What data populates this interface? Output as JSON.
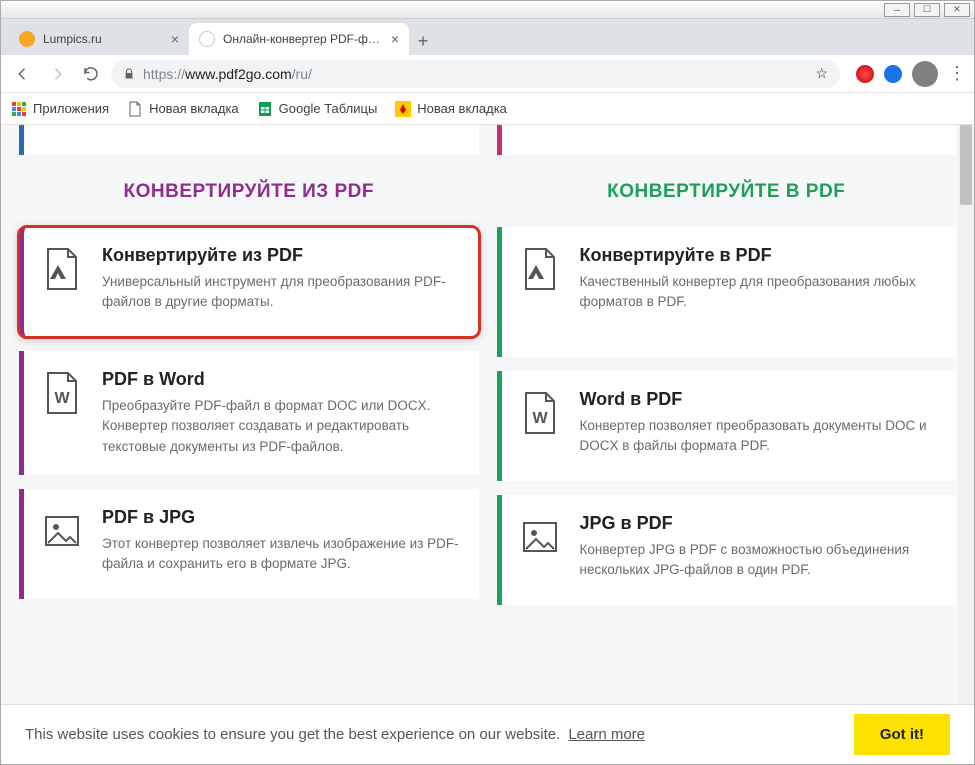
{
  "window": {
    "tabs": [
      {
        "title": "Lumpics.ru",
        "favicon_bg": "#f5a623",
        "active": false
      },
      {
        "title": "Онлайн-конвертер PDF-файлов",
        "favicon_bg": "#fff",
        "active": true
      }
    ],
    "url_scheme": "https://",
    "url_host": "www.pdf2go.com",
    "url_path": "/ru/"
  },
  "bookmarks": [
    {
      "label": "Приложения",
      "icon": "apps"
    },
    {
      "label": "Новая вкладка",
      "icon": "page"
    },
    {
      "label": "Google Таблицы",
      "icon": "sheets"
    },
    {
      "label": "Новая вкладка",
      "icon": "yandex"
    }
  ],
  "section_left_heading": "КОНВЕРТИРУЙТЕ ИЗ PDF",
  "section_right_heading": "КОНВЕРТИРУЙТЕ В PDF",
  "colors": {
    "purple": "#8e2d8e",
    "green": "#1ea05a",
    "pink": "#c72f6f",
    "blue": "#2b6cb0"
  },
  "left_cards": [
    {
      "icon": "pdf",
      "title": "Конвертируйте из PDF",
      "desc": "Универсальный инструмент для преобразования PDF-файлов в другие форматы.",
      "highlighted": true
    },
    {
      "icon": "word",
      "title": "PDF в Word",
      "desc": "Преобразуйте PDF-файл в формат DOC или DOCX. Конвертер позволяет создавать и редактировать текстовые документы из PDF-файлов."
    },
    {
      "icon": "image",
      "title": "PDF в JPG",
      "desc": "Этот конвертер позволяет извлечь изображение из PDF-файла и сохранить его в формате JPG."
    }
  ],
  "right_cards": [
    {
      "icon": "pdf",
      "title": "Конвертируйте в PDF",
      "desc": "Качественный конвертер для преобразования любых форматов в PDF."
    },
    {
      "icon": "word",
      "title": "Word в PDF",
      "desc": "Конвертер позволяет преобразовать документы DOC и DOCX в файлы формата PDF."
    },
    {
      "icon": "image",
      "title": "JPG в PDF",
      "desc": "Конвертер JPG в PDF с возможностью объединения нескольких JPG-файлов в один PDF."
    }
  ],
  "cookie": {
    "text": "This website uses cookies to ensure you get the best experience on our website.",
    "learn": "Learn more",
    "button": "Got it!"
  }
}
